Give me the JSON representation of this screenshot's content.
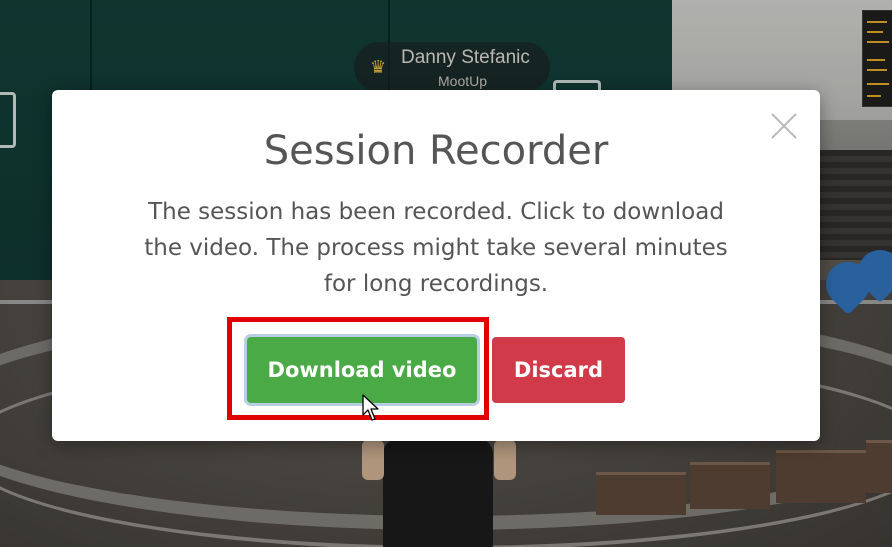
{
  "scene": {
    "nametag": {
      "crown_icon": "crown-icon",
      "name": "Danny Stefanic",
      "organization": "MootUp"
    }
  },
  "modal": {
    "title": "Session Recorder",
    "message": "The session has been recorded. Click to download the video. The process might take several minutes for long recordings.",
    "close_icon": "close-icon",
    "buttons": {
      "download_label": "Download video",
      "discard_label": "Discard"
    }
  },
  "colors": {
    "download_button": "#4aab46",
    "discard_button": "#d13a48",
    "highlight_border": "#e00000",
    "modal_background": "#ffffff",
    "text": "#555555"
  }
}
